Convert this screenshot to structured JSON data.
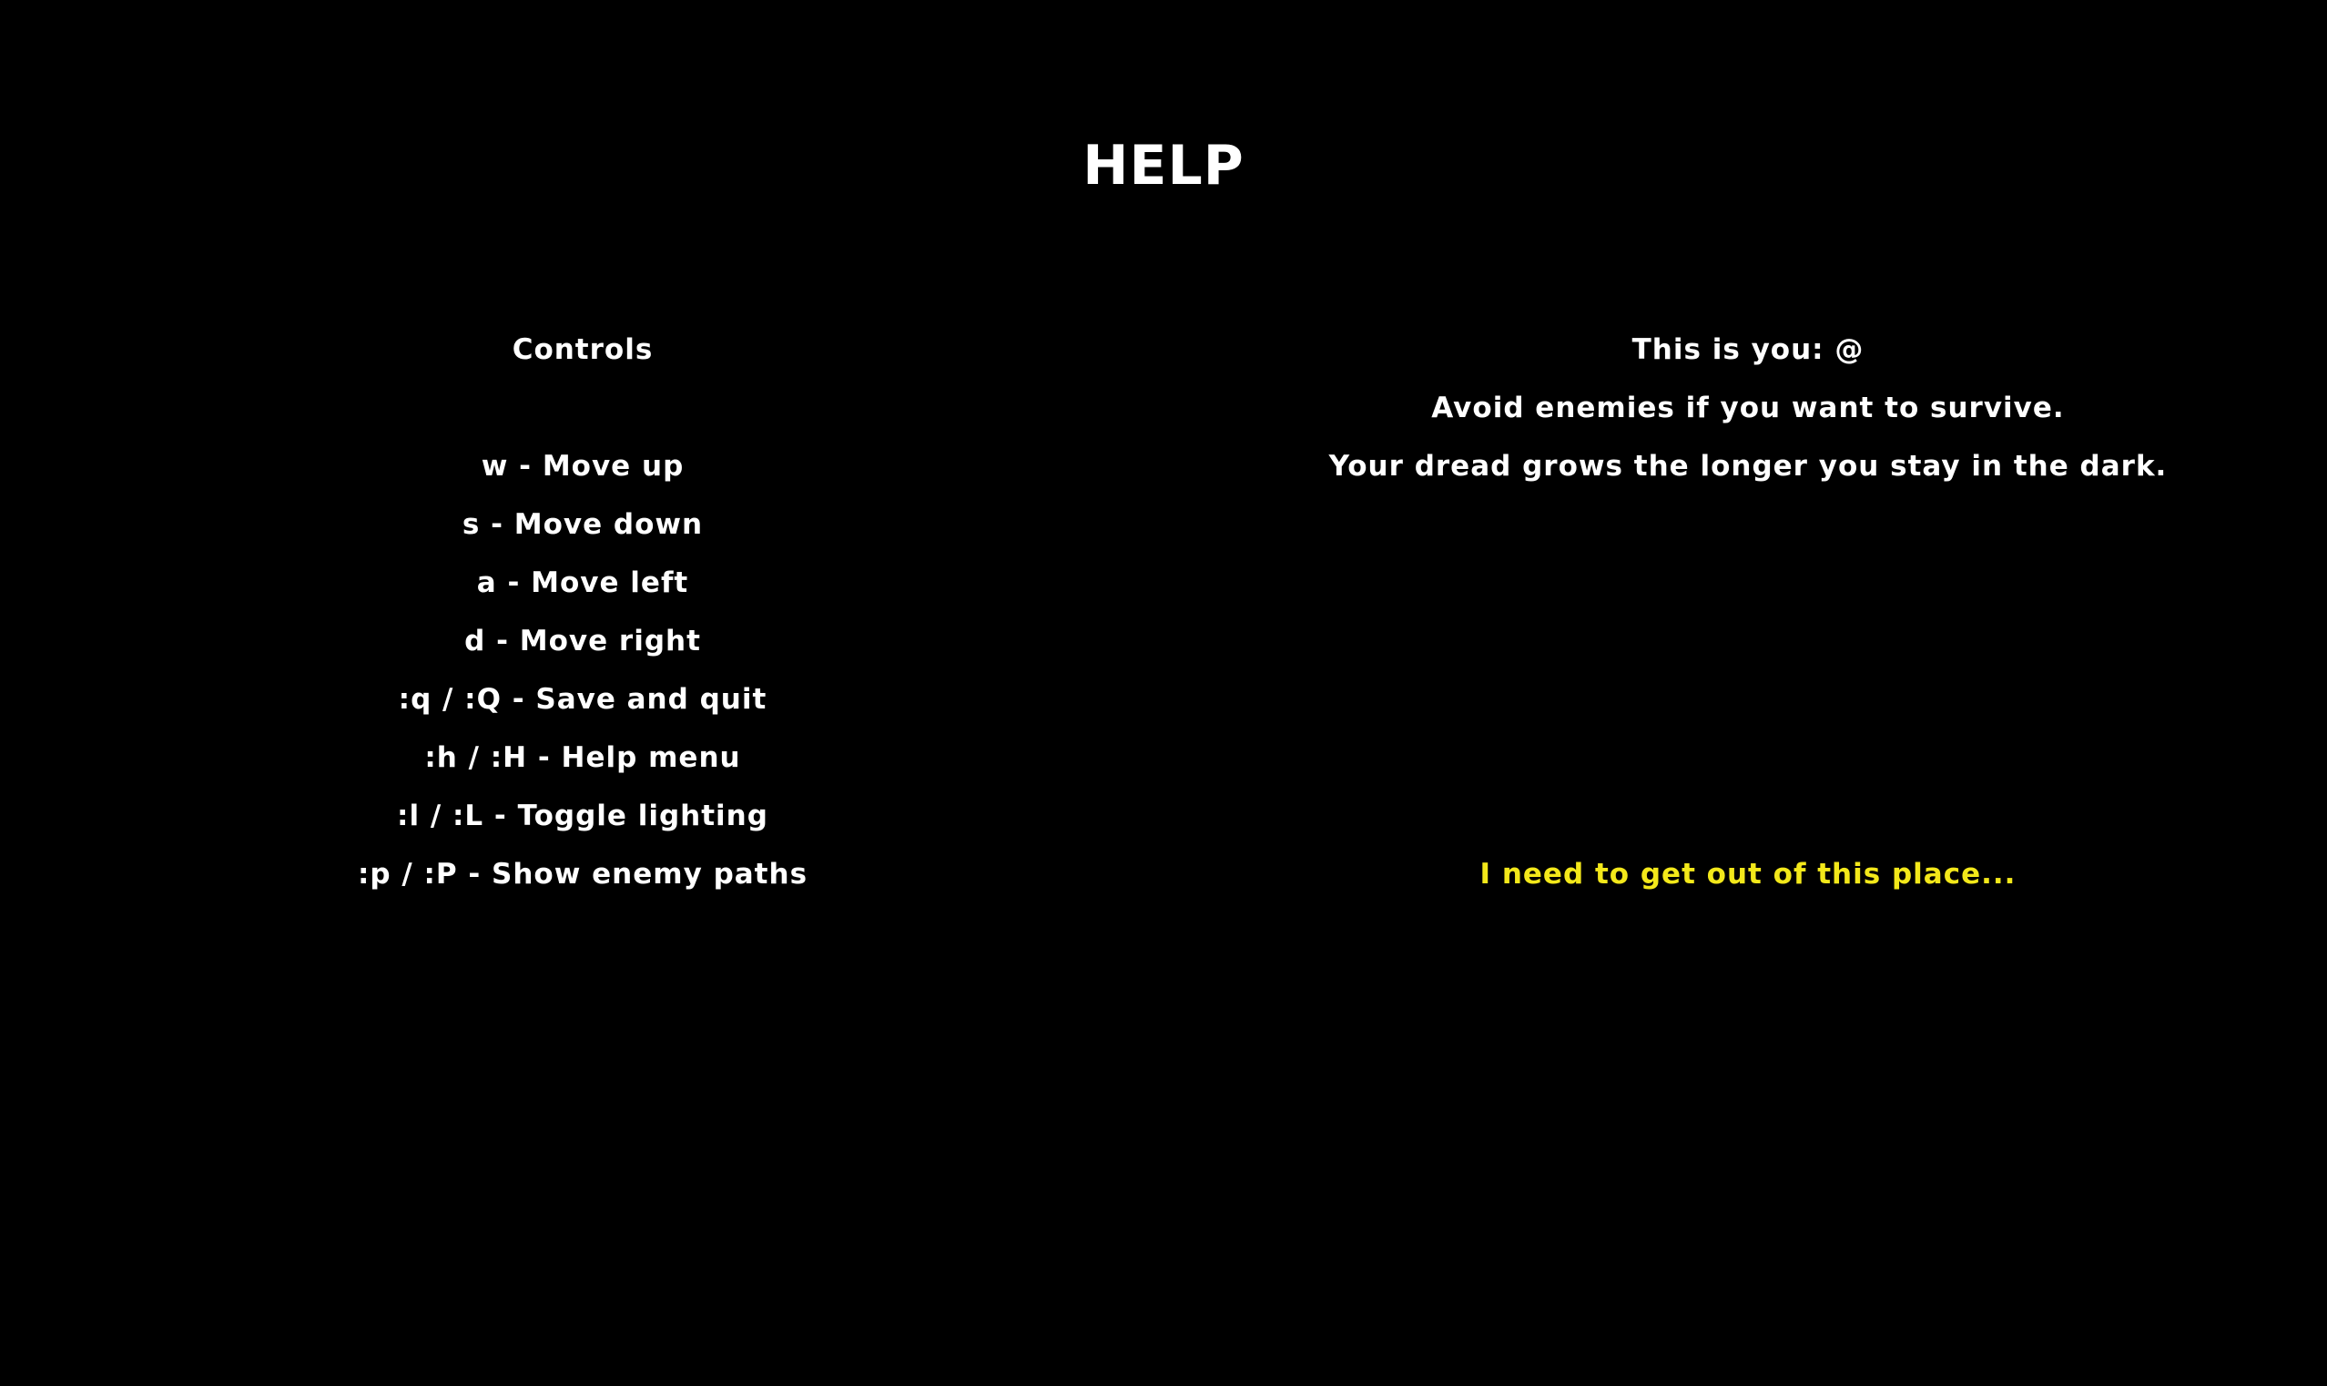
{
  "screen": {
    "title": "HELP"
  },
  "controls": {
    "heading": "Controls",
    "items": [
      "w - Move up",
      "s - Move down",
      "a - Move left",
      "d - Move right",
      ":q / :Q - Save and quit",
      ":h / :H - Help menu",
      ":l / :L - Toggle lighting",
      ":p / :P - Show enemy paths"
    ]
  },
  "info": {
    "lines": [
      "This is you: @",
      "Avoid enemies if you want to survive.",
      "Your dread grows the longer you stay in the dark."
    ],
    "message": "I need to get out of this place..."
  },
  "colors": {
    "background": "#000000",
    "text": "#ffffff",
    "accent": "#f3e81a"
  }
}
